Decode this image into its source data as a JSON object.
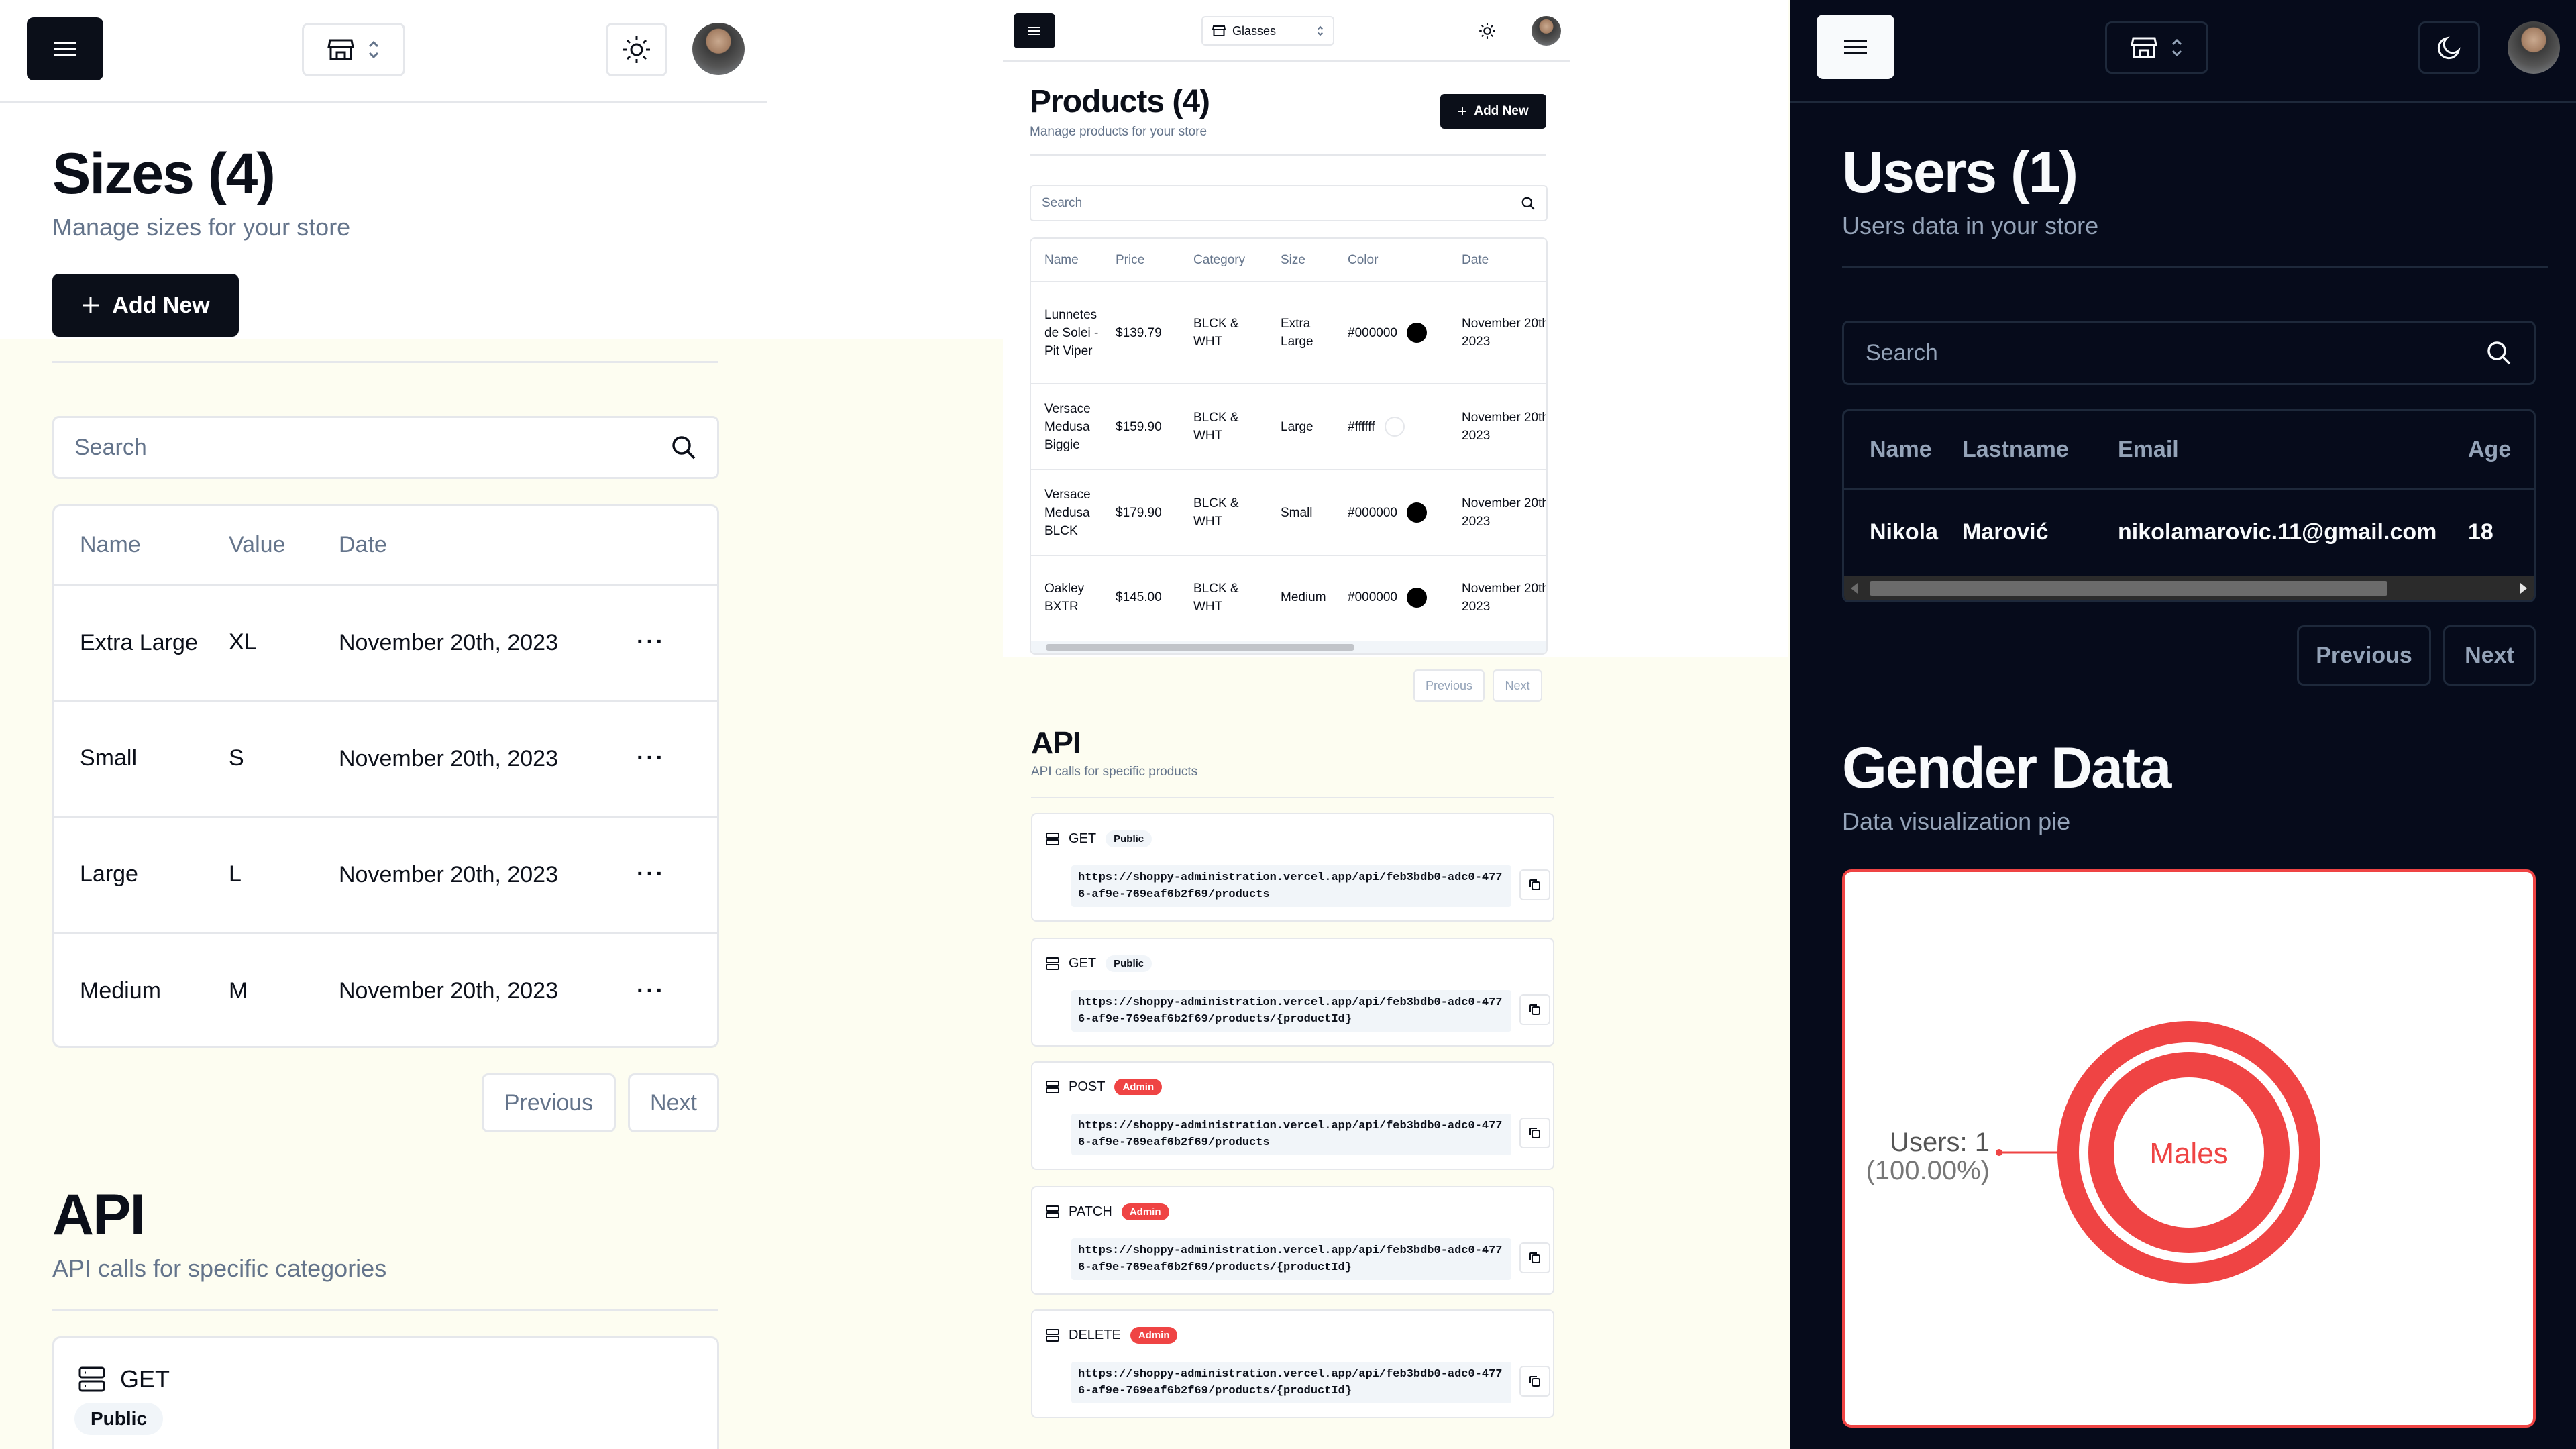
{
  "left": {
    "store_icon": "store-icon",
    "title": "Sizes (4)",
    "subtitle": "Manage sizes for your store",
    "add_button": "Add New",
    "search_placeholder": "Search",
    "table": {
      "headers": [
        "Name",
        "Value",
        "Date"
      ],
      "rows": [
        {
          "name": "Extra Large",
          "value": "XL",
          "date": "November 20th, 2023"
        },
        {
          "name": "Small",
          "value": "S",
          "date": "November 20th, 2023"
        },
        {
          "name": "Large",
          "value": "L",
          "date": "November 20th, 2023"
        },
        {
          "name": "Medium",
          "value": "M",
          "date": "November 20th, 2023"
        }
      ]
    },
    "previous": "Previous",
    "next": "Next",
    "api_title": "API",
    "api_subtitle": "API calls for specific categories",
    "api_card": {
      "method": "GET",
      "badge": "Public"
    }
  },
  "mid": {
    "store_selector": "Glasses",
    "title": "Products (4)",
    "subtitle": "Manage products for your store",
    "add_button": "Add New",
    "search_placeholder": "Search",
    "table": {
      "headers": [
        "Name",
        "Price",
        "Category",
        "Size",
        "Color",
        "Date"
      ],
      "rows": [
        {
          "name": "Lunnetes de Solei - Pit Viper",
          "price": "$139.79",
          "category": "BLCK & WHT",
          "size": "Extra Large",
          "color": "#000000",
          "date": "November 20th, 2023"
        },
        {
          "name": "Versace Medusa Biggie",
          "price": "$159.90",
          "category": "BLCK & WHT",
          "size": "Large",
          "color": "#ffffff",
          "date": "November 20th, 2023"
        },
        {
          "name": "Versace Medusa BLCK",
          "price": "$179.90",
          "category": "BLCK & WHT",
          "size": "Small",
          "color": "#000000",
          "date": "November 20th, 2023"
        },
        {
          "name": "Oakley BXTR",
          "price": "$145.00",
          "category": "BLCK & WHT",
          "size": "Medium",
          "color": "#000000",
          "date": "November 20th, 2023"
        }
      ]
    },
    "previous": "Previous",
    "next": "Next",
    "api_title": "API",
    "api_subtitle": "API calls for specific products",
    "api_cards": [
      {
        "method": "GET",
        "badge": "Public",
        "url": "https://shoppy-administration.vercel.app/api/feb3bdb0-adc0-4776-af9e-769eaf6b2f69/products"
      },
      {
        "method": "GET",
        "badge": "Public",
        "url": "https://shoppy-administration.vercel.app/api/feb3bdb0-adc0-4776-af9e-769eaf6b2f69/products/{productId}"
      },
      {
        "method": "POST",
        "badge": "Admin",
        "url": "https://shoppy-administration.vercel.app/api/feb3bdb0-adc0-4776-af9e-769eaf6b2f69/products"
      },
      {
        "method": "PATCH",
        "badge": "Admin",
        "url": "https://shoppy-administration.vercel.app/api/feb3bdb0-adc0-4776-af9e-769eaf6b2f69/products/{productId}"
      },
      {
        "method": "DELETE",
        "badge": "Admin",
        "url": "https://shoppy-administration.vercel.app/api/feb3bdb0-adc0-4776-af9e-769eaf6b2f69/products/{productId}"
      }
    ]
  },
  "right": {
    "title": "Users (1)",
    "subtitle": "Users data in your store",
    "search_placeholder": "Search",
    "table": {
      "headers": [
        "Name",
        "Lastname",
        "Email",
        "Age"
      ],
      "rows": [
        {
          "name": "Nikola",
          "lastname": "Marović",
          "email": "nikolamarovic.11@gmail.com",
          "age": "18"
        }
      ]
    },
    "previous": "Previous",
    "next": "Next",
    "gender_title": "Gender Data",
    "gender_subtitle": "Data visualization pie",
    "chart_data": {
      "type": "pie",
      "categories": [
        "Males"
      ],
      "values": [
        1
      ],
      "slice_label": "Males",
      "callout_value": "Users: 1",
      "callout_percent": "(100.00%)",
      "colors": [
        "#ef4444"
      ]
    }
  },
  "colors": {
    "dark": "#0b0f19",
    "accent_red": "#ef4444",
    "muted": "#64748b",
    "border": "#e5e7eb"
  }
}
